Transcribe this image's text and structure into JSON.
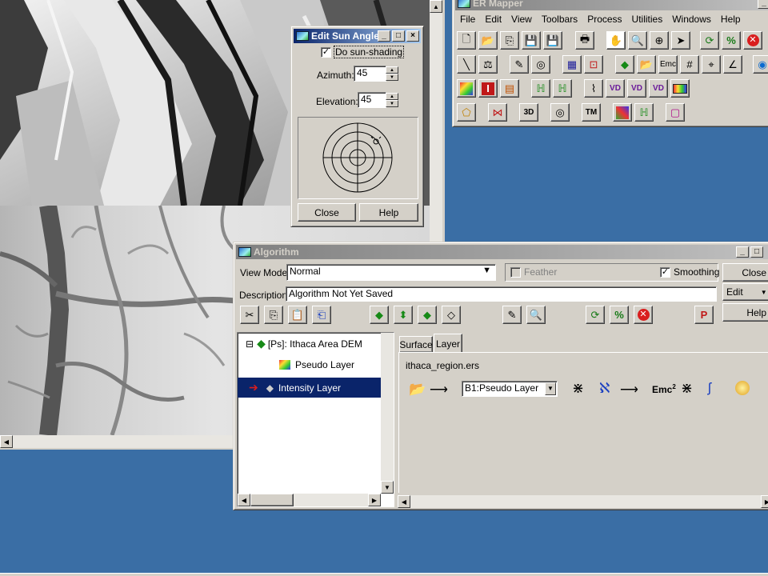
{
  "image_window": {
    "scroll_up": "▲",
    "scroll_left": "◀"
  },
  "sun_dialog": {
    "title": "Edit Sun Angle",
    "shading_checkbox": "Do sun-shading",
    "shading_checked": true,
    "azimuth_label": "Azimuth:",
    "azimuth_value": "45",
    "elevation_label": "Elevation:",
    "elevation_value": "45",
    "close_button": "Close",
    "help_button": "Help"
  },
  "ermapper": {
    "title": "ER Mapper",
    "menu": [
      "File",
      "Edit",
      "View",
      "Toolbars",
      "Process",
      "Utilities",
      "Windows",
      "Help"
    ],
    "toolbar_row1": [
      "new-icon",
      "open-icon",
      "copy-icon",
      "save-icon",
      "save-as-icon",
      "print-icon",
      "hand-icon",
      "zoom-icon",
      "zoom-box-icon",
      "pointer-icon",
      "refresh-icon",
      "percent-icon",
      "stop-icon"
    ],
    "toolbar_row2": [
      "measure-icon",
      "geolink-icon",
      "edit-algorithm-icon",
      "annotate-icon",
      "mosaic-icon",
      "gcp-icon",
      "layers-icon",
      "open-dataset-icon",
      "formula-icon",
      "grid-icon",
      "crosshair-icon",
      "histogram-icon",
      "globe-icon"
    ],
    "toolbar_row3": [
      "palette-icon",
      "info-icon",
      "calc-icon",
      "filter-icon",
      "filter2-icon",
      "profile-icon",
      "vd1-icon",
      "vd2-icon",
      "vd3-icon",
      "colorbar-icon"
    ],
    "toolbar_row4": [
      "polygon-icon",
      "bowtie-icon",
      "3d-icon",
      "fly-icon",
      "tm-icon",
      "classify-icon",
      "wave-icon",
      "box-icon"
    ]
  },
  "algorithm": {
    "title": "Algorithm",
    "view_mode_label": "View Mode:",
    "view_mode_value": "Normal",
    "feather_label": "Feather",
    "feather_checked": false,
    "smoothing_label": "Smoothing",
    "smoothing_checked": true,
    "close_button": "Close",
    "edit_button": "Edit",
    "help_button": "Help",
    "description_label": "Description:",
    "description_value": "Algorithm Not Yet Saved",
    "tree": {
      "root": "[Ps]: Ithaca Area DEM",
      "expander": "⊟",
      "items": [
        "Pseudo Layer",
        "Intensity Layer"
      ],
      "selected_index": 1
    },
    "tabs": [
      "Surface",
      "Layer"
    ],
    "active_tab": "Layer",
    "dataset_name": "ithaca_region.ers",
    "band_select": "B1:Pseudo Layer",
    "formula_text": "Emc",
    "formula_sup": "2"
  },
  "colors": {
    "desktop": "#3a6ea5",
    "title_active": "#0a246a",
    "selection": "#0a246a",
    "stop_red": "#d91e1e"
  }
}
